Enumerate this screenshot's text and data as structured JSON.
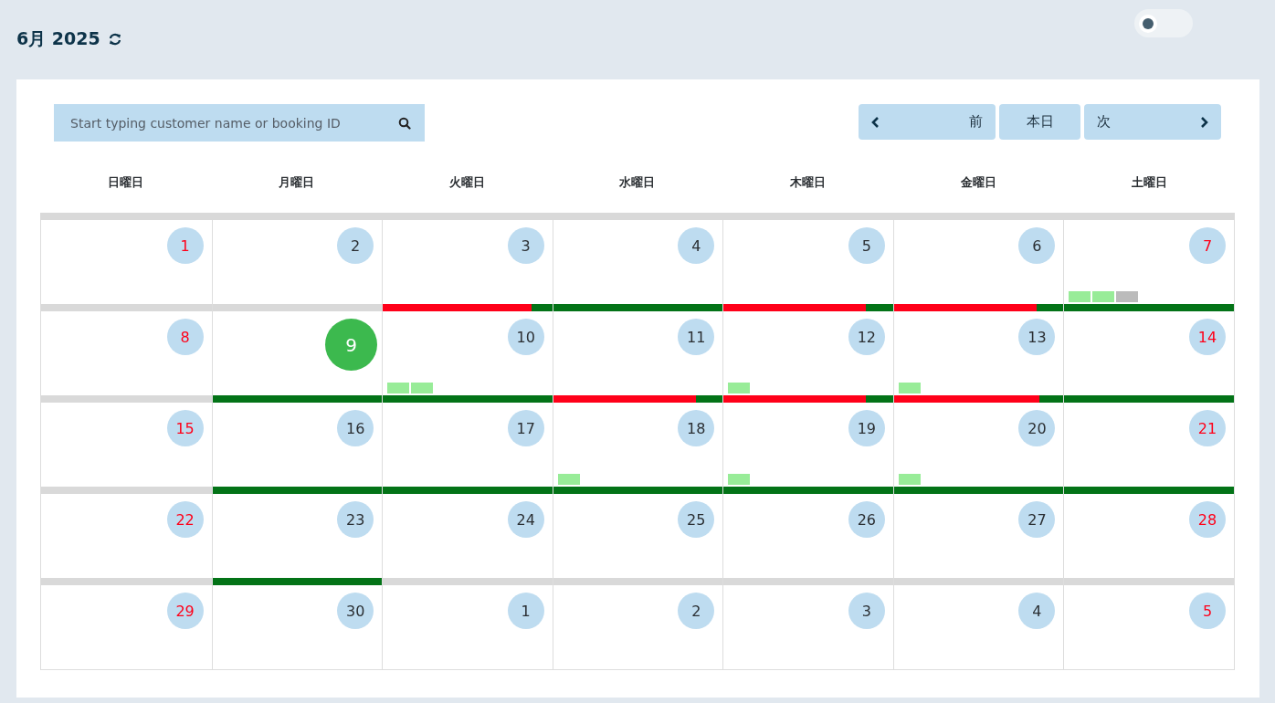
{
  "header": {
    "title": "6月 2025"
  },
  "toggle": {
    "on": false
  },
  "search": {
    "placeholder": "Start typing customer name or booking ID"
  },
  "nav": [
    {
      "label": "前",
      "kind": "prev"
    },
    {
      "label": "本日",
      "kind": "today"
    },
    {
      "label": "次",
      "kind": "next"
    }
  ],
  "calendar": {
    "weekdays": [
      "日曜日",
      "月曜日",
      "火曜日",
      "水曜日",
      "木曜日",
      "金曜日",
      "土曜日"
    ],
    "weeks": [
      {
        "days": [
          {
            "label": "1",
            "weekend": true,
            "today": false,
            "kind": "closed"
          },
          {
            "label": "2",
            "weekend": false,
            "today": false,
            "kind": "closed"
          },
          {
            "label": "3",
            "weekend": false,
            "today": false,
            "kind": "partial",
            "level": 0.88
          },
          {
            "label": "4",
            "weekend": false,
            "today": false,
            "kind": "open"
          },
          {
            "label": "5",
            "weekend": false,
            "today": false,
            "kind": "partial",
            "level": 0.84
          },
          {
            "label": "6",
            "weekend": false,
            "today": false,
            "kind": "partial",
            "level": 0.84
          },
          {
            "label": "7",
            "weekend": true,
            "today": false,
            "kind": "open",
            "chips": [
              {
                "color": "#98ec98"
              },
              {
                "color": "#98ec98"
              },
              {
                "color": "#bbbbbb"
              }
            ]
          }
        ]
      },
      {
        "days": [
          {
            "label": "8",
            "weekend": true,
            "today": false,
            "kind": "closed"
          },
          {
            "label": "9",
            "weekend": false,
            "today": true,
            "kind": "open"
          },
          {
            "label": "10",
            "weekend": false,
            "today": false,
            "kind": "open",
            "chips": [
              {
                "color": "#98ec98"
              },
              {
                "color": "#98ec98"
              }
            ]
          },
          {
            "label": "11",
            "weekend": false,
            "today": false,
            "kind": "partial",
            "level": 0.84
          },
          {
            "label": "12",
            "weekend": false,
            "today": false,
            "kind": "partial",
            "level": 0.84,
            "chips": [
              {
                "color": "#98ec98"
              }
            ]
          },
          {
            "label": "13",
            "weekend": false,
            "today": false,
            "kind": "partial",
            "level": 0.86,
            "chips": [
              {
                "color": "#98ec98"
              }
            ]
          },
          {
            "label": "14",
            "weekend": true,
            "today": false,
            "kind": "open"
          }
        ]
      },
      {
        "days": [
          {
            "label": "15",
            "weekend": true,
            "today": false,
            "kind": "closed"
          },
          {
            "label": "16",
            "weekend": false,
            "today": false,
            "kind": "open"
          },
          {
            "label": "17",
            "weekend": false,
            "today": false,
            "kind": "open"
          },
          {
            "label": "18",
            "weekend": false,
            "today": false,
            "kind": "open",
            "chips": [
              {
                "color": "#98ec98"
              }
            ]
          },
          {
            "label": "19",
            "weekend": false,
            "today": false,
            "kind": "open",
            "chips": [
              {
                "color": "#98ec98"
              }
            ]
          },
          {
            "label": "20",
            "weekend": false,
            "today": false,
            "kind": "open",
            "chips": [
              {
                "color": "#98ec98"
              }
            ]
          },
          {
            "label": "21",
            "weekend": true,
            "today": false,
            "kind": "open"
          }
        ]
      },
      {
        "days": [
          {
            "label": "22",
            "weekend": true,
            "today": false,
            "kind": "closed"
          },
          {
            "label": "23",
            "weekend": false,
            "today": false,
            "kind": "open"
          },
          {
            "label": "24",
            "weekend": false,
            "today": false,
            "kind": "closed"
          },
          {
            "label": "25",
            "weekend": false,
            "today": false,
            "kind": "closed"
          },
          {
            "label": "26",
            "weekend": false,
            "today": false,
            "kind": "closed"
          },
          {
            "label": "27",
            "weekend": false,
            "today": false,
            "kind": "closed"
          },
          {
            "label": "28",
            "weekend": true,
            "today": false,
            "kind": "closed"
          }
        ]
      },
      {
        "days": [
          {
            "label": "29",
            "weekend": true,
            "today": false
          },
          {
            "label": "30",
            "weekend": false,
            "today": false
          },
          {
            "label": "1",
            "weekend": false,
            "today": false
          },
          {
            "label": "2",
            "weekend": false,
            "today": false
          },
          {
            "label": "3",
            "weekend": false,
            "today": false
          },
          {
            "label": "4",
            "weekend": false,
            "today": false
          },
          {
            "label": "5",
            "weekend": true,
            "today": false
          }
        ]
      }
    ]
  }
}
